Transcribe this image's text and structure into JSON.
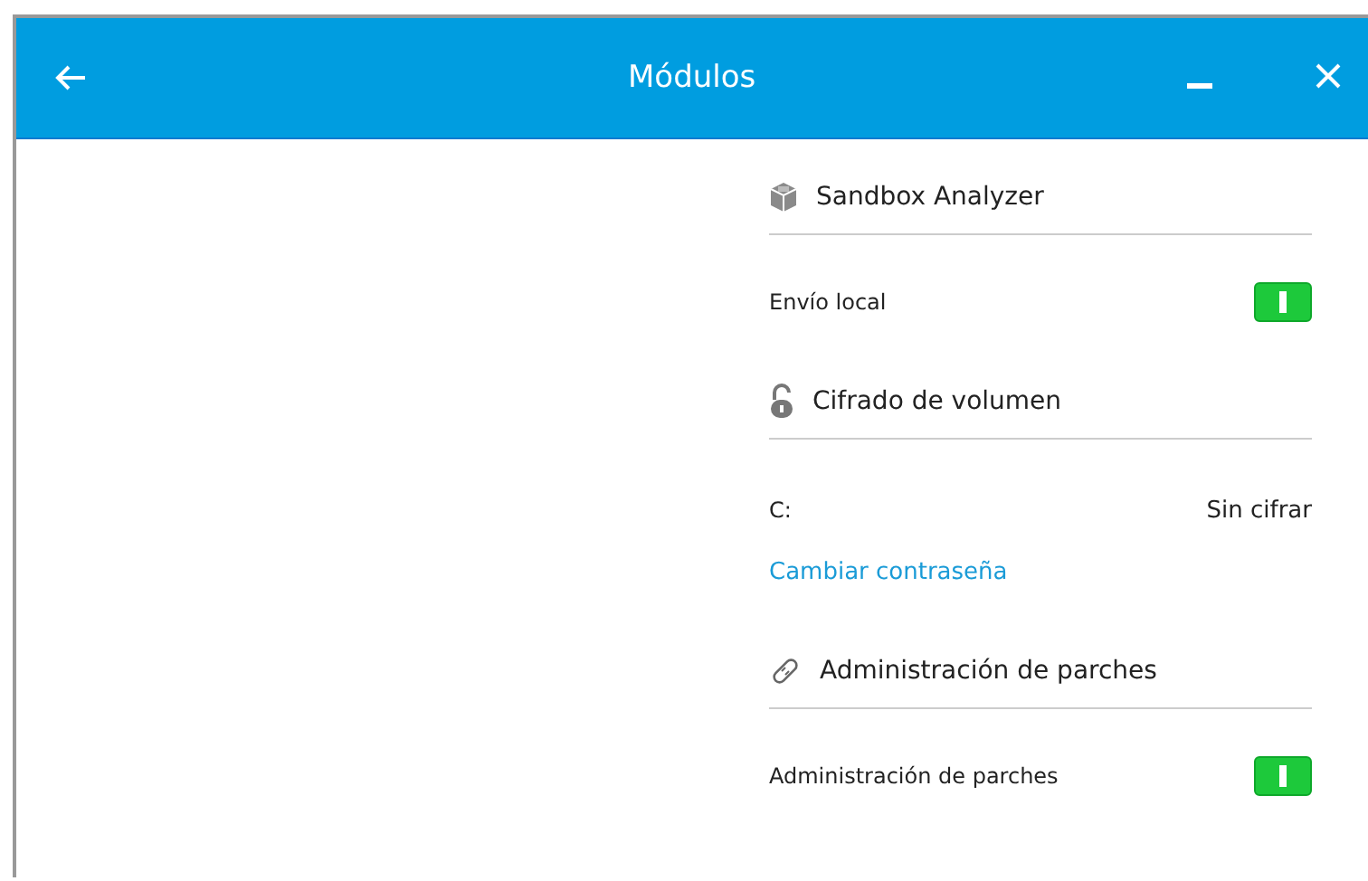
{
  "window": {
    "title": "Módulos"
  },
  "sections": [
    {
      "title": "Sandbox Analyzer",
      "rows": [
        {
          "kind": "toggle",
          "label": "Envío local",
          "on": true
        }
      ]
    },
    {
      "title": "Cifrado de volumen",
      "rows": [
        {
          "kind": "value",
          "label": "C:",
          "value": "Sin cifrar"
        },
        {
          "kind": "link",
          "label": "Cambiar contraseña"
        }
      ]
    },
    {
      "title": "Administración de parches",
      "rows": [
        {
          "kind": "toggle",
          "label": "Administración de parches",
          "on": true
        }
      ]
    }
  ]
}
